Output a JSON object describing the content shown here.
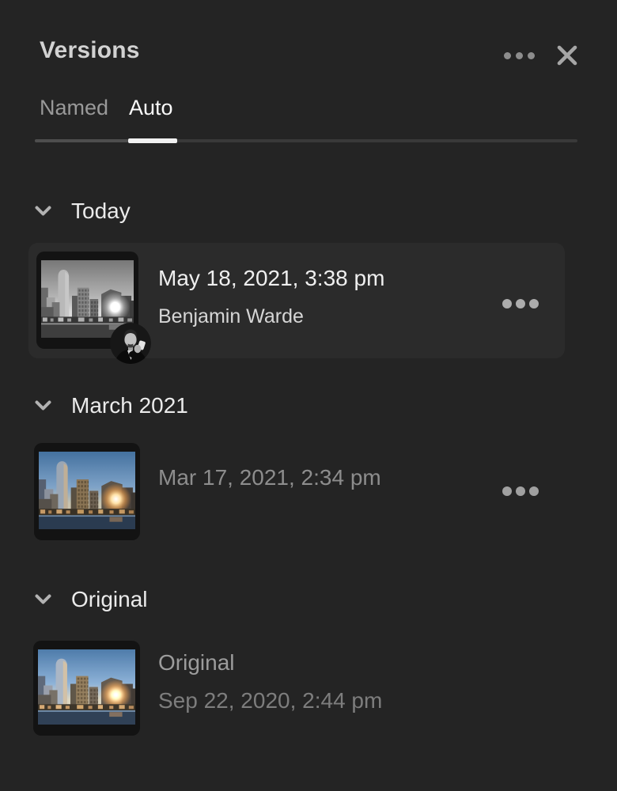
{
  "panel": {
    "title": "Versions"
  },
  "tabs": {
    "named": "Named",
    "auto": "Auto",
    "active_tab": "Auto"
  },
  "sections": {
    "today": {
      "label": "Today",
      "row": {
        "title": "May 18, 2021, 3:38 pm",
        "subtitle": "Benjamin Warde",
        "selected": true,
        "avatar": "Benjamin Warde"
      }
    },
    "march": {
      "label": "March 2021",
      "row": {
        "title": "Mar 17, 2021, 2:34 pm"
      }
    },
    "original": {
      "label": "Original",
      "row": {
        "title": "Original",
        "subtitle": "Sep 22, 2020, 2:44 pm"
      }
    }
  },
  "icons": {
    "header_more": "ellipsis-horizontal",
    "close": "x",
    "section_chevron": "chevron-down",
    "row_more": "ellipsis-horizontal"
  },
  "colors": {
    "background": "#242424",
    "selected_row_background": "#2b2b2b",
    "active_tab_underline": "#f1f1f1",
    "inactive_tab_text": "#999999",
    "primary_text": "#efefef",
    "secondary_text": "#8d8d8d",
    "thumbnail_frame": "#131313"
  }
}
